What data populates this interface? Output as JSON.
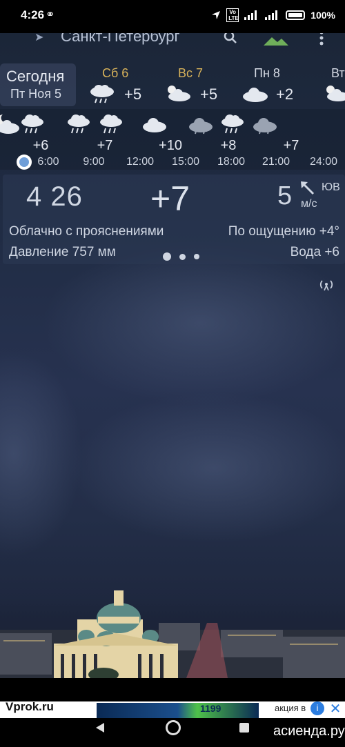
{
  "status_bar": {
    "time": "4:26",
    "link_icon": "link-icon",
    "network": "4G",
    "volte": "Vo LTE",
    "battery": "100%"
  },
  "app_bar": {
    "city": "Санкт-Петербург"
  },
  "days": {
    "today_label": "Сегодня",
    "today_date": "Пт Ноя 5",
    "items": [
      {
        "name": "Сб 6",
        "temp": "+5",
        "icon": "rain-icon",
        "weekend": true
      },
      {
        "name": "Вс 7",
        "temp": "+5",
        "icon": "partly-cloudy-icon",
        "weekend": true
      },
      {
        "name": "Пн 8",
        "temp": "+2",
        "icon": "cloudy-icon",
        "weekend": false
      },
      {
        "name": "Вт",
        "temp": "",
        "icon": "partly-cloudy-icon",
        "weekend": false
      }
    ]
  },
  "hourly": {
    "temps": [
      "+6",
      "+7",
      "+10",
      "+8",
      "+7"
    ],
    "times": [
      "6:00",
      "9:00",
      "12:00",
      "15:00",
      "18:00",
      "21:00",
      "24:00"
    ]
  },
  "current": {
    "time": "4 26",
    "temp": "+7",
    "wind_speed": "5",
    "wind_dir": "ЮВ",
    "wind_unit": "м/с",
    "condition": "Облачно с прояснениями",
    "feels_like": "По ощущению +4°",
    "pressure": "Давление 757 мм",
    "water": "Вода +6"
  },
  "ad": {
    "left_text": "Vprok.ru",
    "banner_text": "1199",
    "right_text": "акция в",
    "info": "i",
    "close": "✕"
  },
  "watermark": "асиенда.ру",
  "colors": {
    "weekend_day": "#d7b25a",
    "background": "#202c44"
  }
}
